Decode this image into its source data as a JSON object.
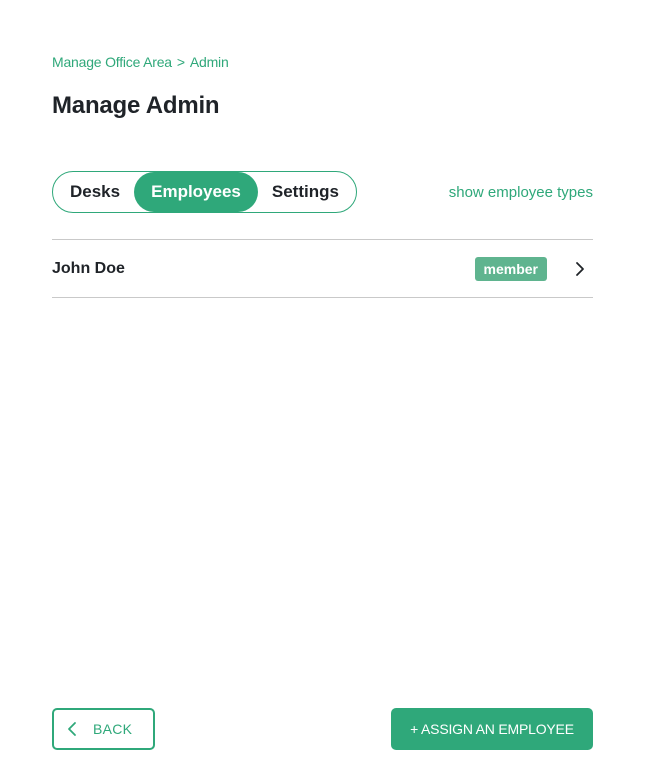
{
  "breadcrumb": {
    "parent": "Manage Office Area",
    "separator": ">",
    "current": "Admin"
  },
  "page": {
    "title": "Manage Admin"
  },
  "tabs": [
    {
      "label": "Desks",
      "active": false
    },
    {
      "label": "Employees",
      "active": true
    },
    {
      "label": "Settings",
      "active": false
    }
  ],
  "show_types_link": "show employee types",
  "employees": [
    {
      "name": "John Doe",
      "role": "member",
      "icon": "chevron-right-icon"
    }
  ],
  "footer": {
    "back_label": "BACK",
    "back_icon": "chevron-left-icon",
    "assign_label": "+ ASSIGN AN EMPLOYEE"
  },
  "colors": {
    "accent": "#2fa87a",
    "badge": "#5fb48f",
    "divider": "#c9c9c9",
    "text": "#1f2328"
  }
}
